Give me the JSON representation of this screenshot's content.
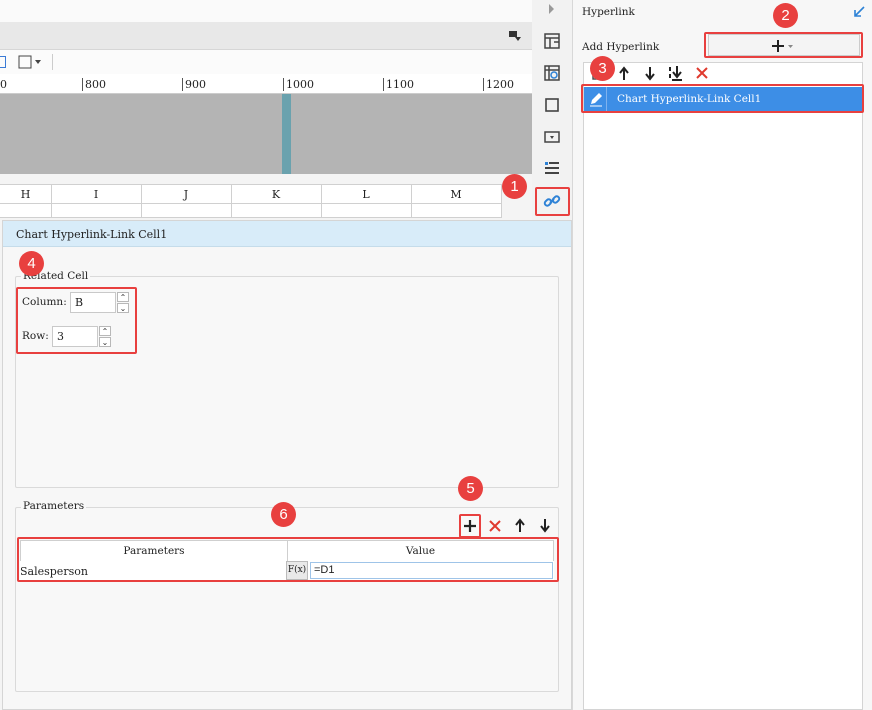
{
  "ruler": {
    "ticks": [
      "0",
      "800",
      "900",
      "1000",
      "1100",
      "1200"
    ]
  },
  "columns": [
    "H",
    "I",
    "J",
    "K",
    "L",
    "M"
  ],
  "editor": {
    "title": "Chart Hyperlink-Link Cell1",
    "related_cell_label": "Related Cell",
    "column_label": "Column:",
    "column_value": "B",
    "row_label": "Row:",
    "row_value": "3",
    "parameters_label": "Parameters",
    "table": {
      "headers": [
        "Parameters",
        "Value"
      ],
      "rows": [
        {
          "name": "Salesperson",
          "formula_icon": "F(x)",
          "value": "=D1"
        }
      ]
    }
  },
  "right_panel": {
    "title": "Hyperlink",
    "add_label": "Add Hyperlink",
    "items": [
      "Chart Hyperlink-Link Cell1"
    ]
  },
  "badges": [
    "1",
    "2",
    "3",
    "4",
    "5",
    "6"
  ],
  "colors": {
    "highlight": "#e8403f",
    "selection": "#3d8ee6",
    "accent": "#2e82d6"
  },
  "icons": [
    "dock-icon",
    "layout-icon",
    "cell-attributes-icon",
    "border-icon",
    "widget-icon",
    "conditional-icon",
    "hyperlink-icon",
    "add-icon",
    "delete-icon",
    "move-up-icon",
    "move-down-icon",
    "move-bottom-icon",
    "edit-icon",
    "collapse-arrow-icon",
    "expand-icon"
  ]
}
